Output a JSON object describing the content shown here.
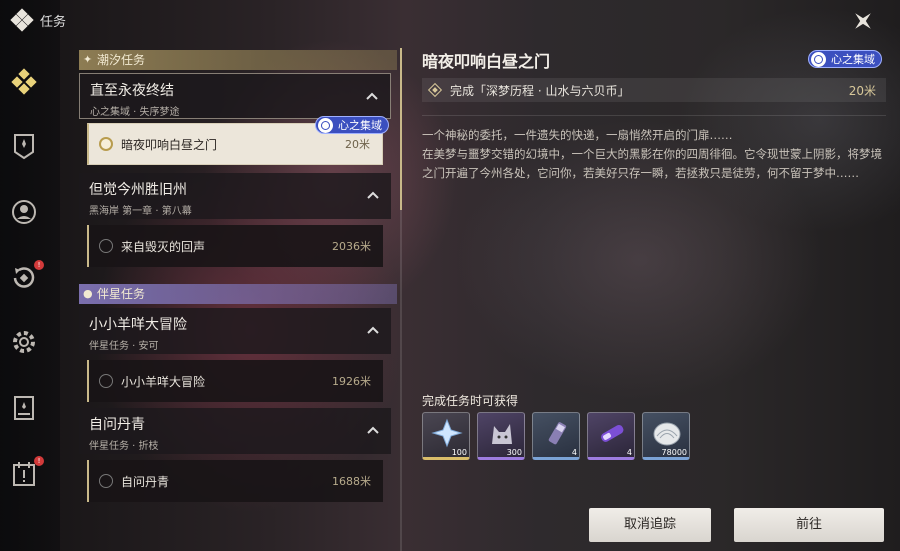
{
  "header": {
    "title": "任务"
  },
  "sidebar": {
    "items": [
      {
        "name": "quest-icon",
        "badge": ""
      },
      {
        "name": "achievement-icon",
        "badge": ""
      },
      {
        "name": "companion-icon",
        "badge": ""
      },
      {
        "name": "daily-icon",
        "badge": "!"
      },
      {
        "name": "settings-icon",
        "badge": ""
      },
      {
        "name": "journal-icon",
        "badge": ""
      },
      {
        "name": "event-icon",
        "badge": "!"
      }
    ]
  },
  "list": {
    "categories": [
      {
        "label": "潮汐任务"
      },
      {
        "label": "伴星任务"
      }
    ],
    "groups": [
      {
        "name": "直至永夜终结",
        "sub": "心之集域 · 失序梦途"
      },
      {
        "name": "但觉今州胜旧州",
        "sub": "黑海岸 第一章 · 第八幕"
      },
      {
        "name": "小小羊咩大冒险",
        "sub": "伴星任务 · 安可"
      },
      {
        "name": "自问丹青",
        "sub": "伴星任务 · 折枝"
      }
    ],
    "quests": [
      {
        "name": "暗夜叩响白昼之门",
        "dist": "20米"
      },
      {
        "name": "来自毁灭的回声",
        "dist": "2036米"
      },
      {
        "name": "小小羊咩大冒险",
        "dist": "1926米"
      },
      {
        "name": "自问丹青",
        "dist": "1688米"
      }
    ],
    "tag": "心之集域"
  },
  "detail": {
    "title": "暗夜叩响白昼之门",
    "tag": "心之集域",
    "objective": "完成「深梦历程 · 山水与六贝币」",
    "objective_dist": "20米",
    "desc_line1": "一个神秘的委托，一件遗失的快递，一扇悄然开启的门扉……",
    "desc_line2": "在美梦与噩梦交错的幻境中，一个巨大的黑影在你的四周徘徊。它令现世蒙上阴影，将梦境之门开遍了今州各处，它问你，若美好只存一瞬，若拯救只是徒劳，何不留于梦中……",
    "rewards_title": "完成任务时可获得",
    "rewards": [
      {
        "icon": "crystal-icon",
        "count": "100",
        "rarity": "gold"
      },
      {
        "icon": "wolf-echo-icon",
        "count": "300",
        "rarity": "purple"
      },
      {
        "icon": "potion-icon",
        "count": "4",
        "rarity": "blue"
      },
      {
        "icon": "capsule-icon",
        "count": "4",
        "rarity": "purple"
      },
      {
        "icon": "shell-coin-icon",
        "count": "78000",
        "rarity": "blue"
      }
    ]
  },
  "buttons": {
    "cancel": "取消追踪",
    "go": "前往"
  },
  "colors": {
    "accent_gold": "#c9b98a",
    "tag_blue": "#3b4fbf",
    "badge_red": "#d23a3a"
  }
}
